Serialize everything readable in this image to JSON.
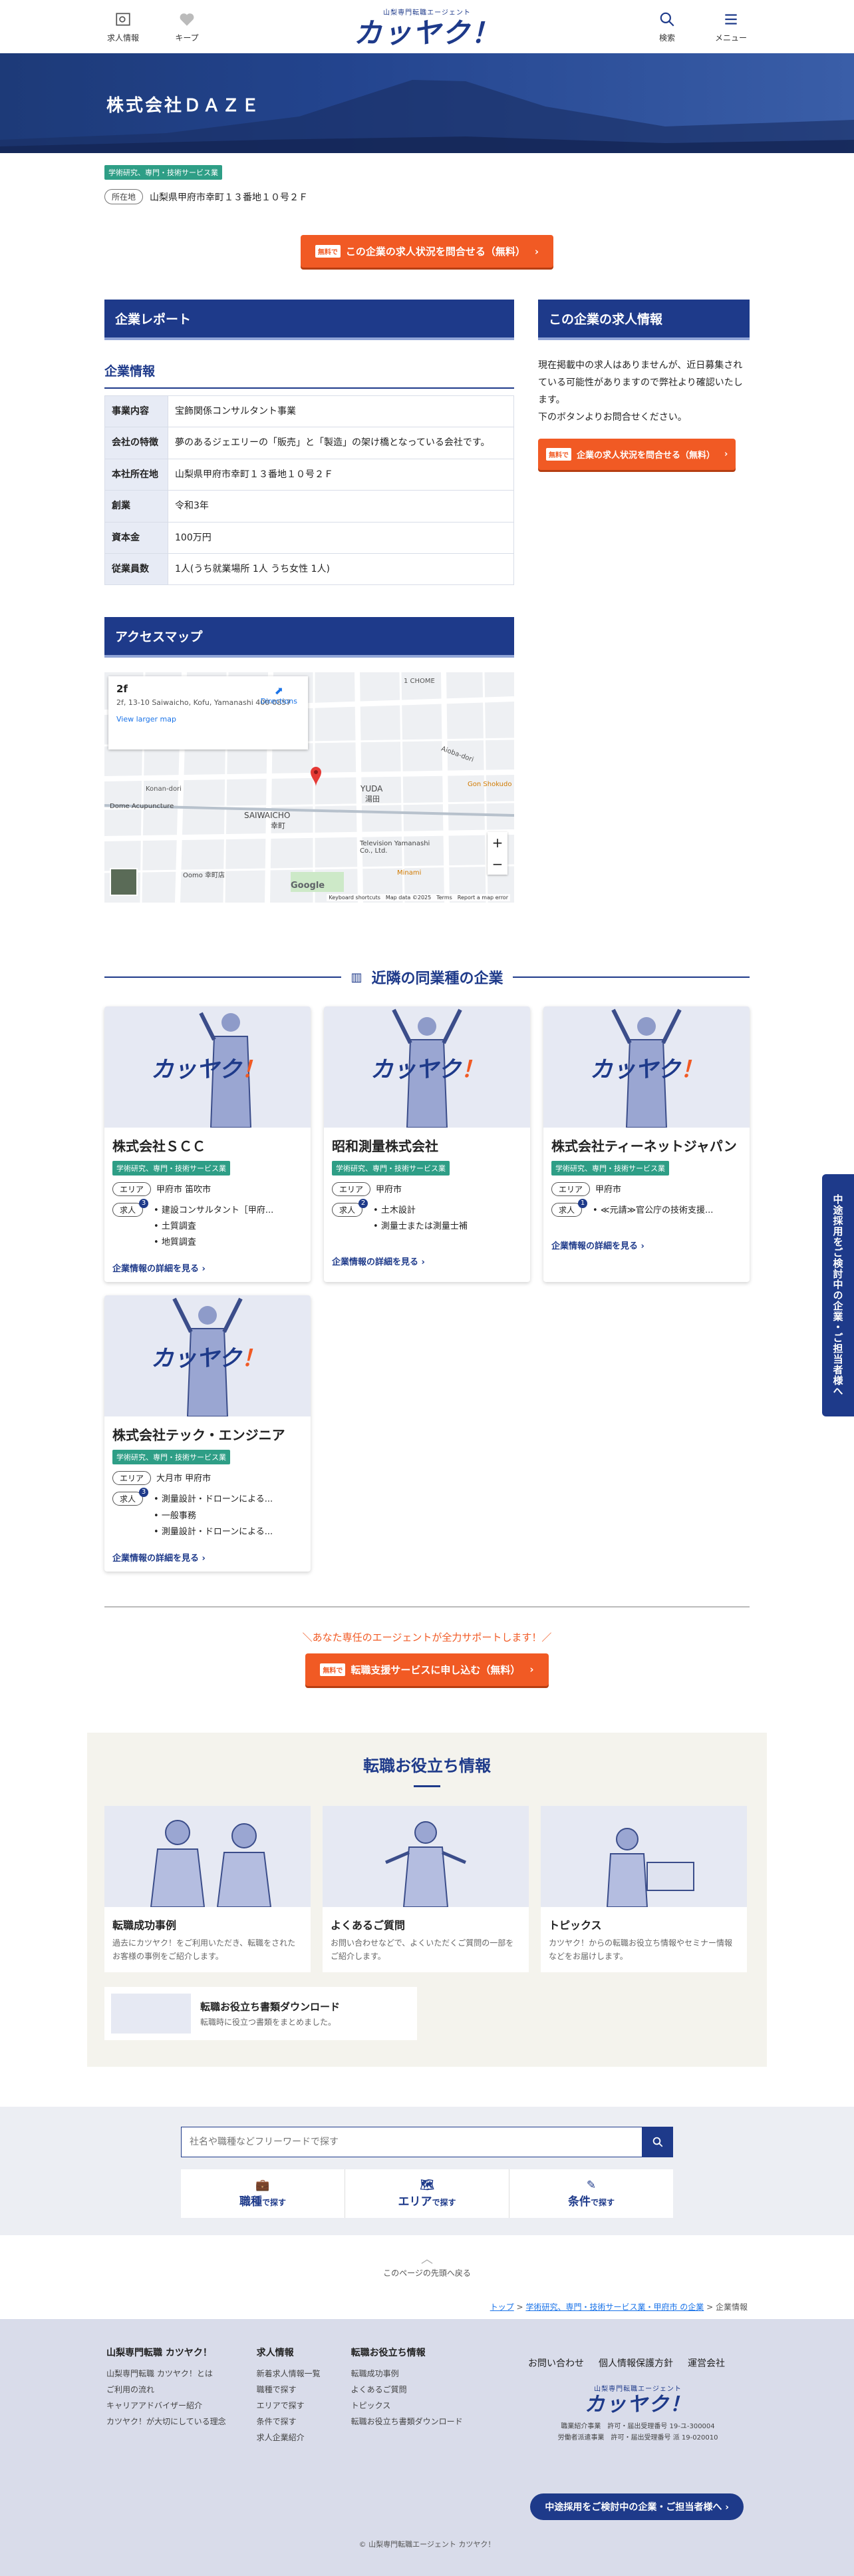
{
  "header": {
    "logo_sub": "山梨専門転職エージェント",
    "logo_main": "カッヤク！",
    "jobs_label": "求人情報",
    "keep_label": "キープ",
    "search_label": "検索",
    "menu_label": "メニュー"
  },
  "company": {
    "name": "株式会社ＤＡＺＥ",
    "industry_tag": "学術研究、専門・技術サービス業",
    "location_label": "所在地",
    "address": "山梨県甲府市幸町１３番地１０号２Ｆ"
  },
  "cta": {
    "mini": "無料で",
    "inquire_label": "この企業の求人状況を問合せる（無料）"
  },
  "report": {
    "title": "企業レポート",
    "info_title": "企業情報",
    "rows": [
      {
        "k": "事業内容",
        "v": "宝飾関係コンサルタント事業"
      },
      {
        "k": "会社の特徴",
        "v": "夢のあるジェエリーの「販売」と「製造」の架け橋となっている会社です。"
      },
      {
        "k": "本社所在地",
        "v": "山梨県甲府市幸町１３番地１０号２Ｆ"
      },
      {
        "k": "創業",
        "v": "令和3年"
      },
      {
        "k": "資本金",
        "v": "100万円"
      },
      {
        "k": "従業員数",
        "v": "1人(うち就業場所 1人 うち女性 1人)"
      }
    ]
  },
  "side": {
    "title": "この企業の求人情報",
    "text1": "現在掲載中の求人はありませんが、近日募集されている可能性がありますので弊社より確認いたします。",
    "text2": "下のボタンよりお問合せください。",
    "mini": "無料で",
    "button": "企業の求人状況を問合せる（無料）"
  },
  "access": {
    "title": "アクセスマップ",
    "card_title": "2f",
    "card_addr": "2f, 13-10 Saiwaicho, Kofu, Yamanashi 400-0857",
    "card_link": "View larger map",
    "card_dir": "Directions",
    "labels": [
      "1 CHOME",
      "Aioba-dori",
      "Konan-dori",
      "YUDA",
      "湯田",
      "SAIWAICHO",
      "幸町",
      "Television Yamanashi Co., Ltd.",
      "Minami",
      "Gon Shokudo",
      "Dome Acupuncture",
      "Oomo 幸町店",
      "Google",
      "Keyboard shortcuts",
      "Map data ©2025",
      "Terms",
      "Report a map error"
    ]
  },
  "nearby": {
    "title": "近隣の同業種の企業",
    "cards": [
      {
        "name": "株式会社ＳＣＣ",
        "tag": "学術研究、専門・技術サービス業",
        "area_label": "エリア",
        "area": "甲府市 笛吹市",
        "jobs_label": "求人",
        "count": "3",
        "jobs": [
          "建設コンサルタント［甲府...",
          "土質調査",
          "地質調査"
        ],
        "more": "企業情報の詳細を見る"
      },
      {
        "name": "昭和測量株式会社",
        "tag": "学術研究、専門・技術サービス業",
        "area_label": "エリア",
        "area": "甲府市",
        "jobs_label": "求人",
        "count": "2",
        "jobs": [
          "土木設計",
          "測量士または測量士補"
        ],
        "more": "企業情報の詳細を見る"
      },
      {
        "name": "株式会社ティーネットジャパン",
        "tag": "学術研究、専門・技術サービス業",
        "area_label": "エリア",
        "area": "甲府市",
        "jobs_label": "求人",
        "count": "1",
        "jobs": [
          "≪元請≫官公庁の技術支援..."
        ],
        "more": "企業情報の詳細を見る"
      },
      {
        "name": "株式会社テック・エンジニア",
        "tag": "学術研究、専門・技術サービス業",
        "area_label": "エリア",
        "area": "大月市 甲府市",
        "jobs_label": "求人",
        "count": "3",
        "jobs": [
          "測量設計・ドローンによる...",
          "一般事務",
          "測量設計・ドローンによる..."
        ],
        "more": "企業情報の詳細を見る"
      }
    ]
  },
  "support": {
    "caption": "＼あなた専任のエージェントが全力サポートします！／",
    "mini": "無料で",
    "button": "転職支援サービスに申し込む（無料）"
  },
  "useful": {
    "title": "転職お役立ち情報",
    "cards": [
      {
        "title": "転職成功事例",
        "text": "過去にカツヤク！をご利用いただき、転職をされたお客様の事例をご紹介します。"
      },
      {
        "title": "よくあるご質問",
        "text": "お問い合わせなどで、よくいただくご質問の一部をご紹介します。"
      },
      {
        "title": "トピックス",
        "text": "カツヤク！からの転職お役立ち情報やセミナー情報などをお届けします。"
      }
    ],
    "download_title": "転職お役立ち書類ダウンロード",
    "download_text": "転職時に役立つ書類をまとめました。"
  },
  "search": {
    "placeholder": "社名や職種などフリーワードで探す",
    "tabs": [
      {
        "main": "職種",
        "sub": "で探す"
      },
      {
        "main": "エリア",
        "sub": "で探す"
      },
      {
        "main": "条件",
        "sub": "で探す"
      }
    ]
  },
  "totop": "このページの先頭へ戻る",
  "breadcrumb": {
    "top": "トップ",
    "cat": "学術研究、専門・技術サービス業・甲府市 の企業",
    "sep": ">",
    "current": "企業情報"
  },
  "footer": {
    "col1_title": "山梨専門転職 カツヤク！",
    "col1": [
      "山梨専門転職 カツヤク！とは",
      "ご利用の流れ",
      "キャリアアドバイザー紹介",
      "カツヤク！が大切にしている理念"
    ],
    "col2_title": "求人情報",
    "col2": [
      "新着求人情報一覧",
      "職種で探す",
      "エリアで探す",
      "条件で探す",
      "求人企業紹介"
    ],
    "col3_title": "転職お役立ち情報",
    "col3": [
      "転職成功事例",
      "よくあるご質問",
      "トピックス",
      "転職お役立ち書類ダウンロード"
    ],
    "links": [
      "お問い合わせ",
      "個人情報保護方針",
      "運営会社"
    ],
    "license1": "職業紹介事業　許可・届出受理番号 19-ユ-300004",
    "license2": "労働者派遣事業　許可・届出受理番号 派 19-020010",
    "button": "中途採用をご検討中の企業・ご担当者様へ",
    "copyright": "© 山梨専門転職エージェント カツヤク！"
  },
  "side_banner": "中途採用をご検討中の企業・ご担当者様へ"
}
